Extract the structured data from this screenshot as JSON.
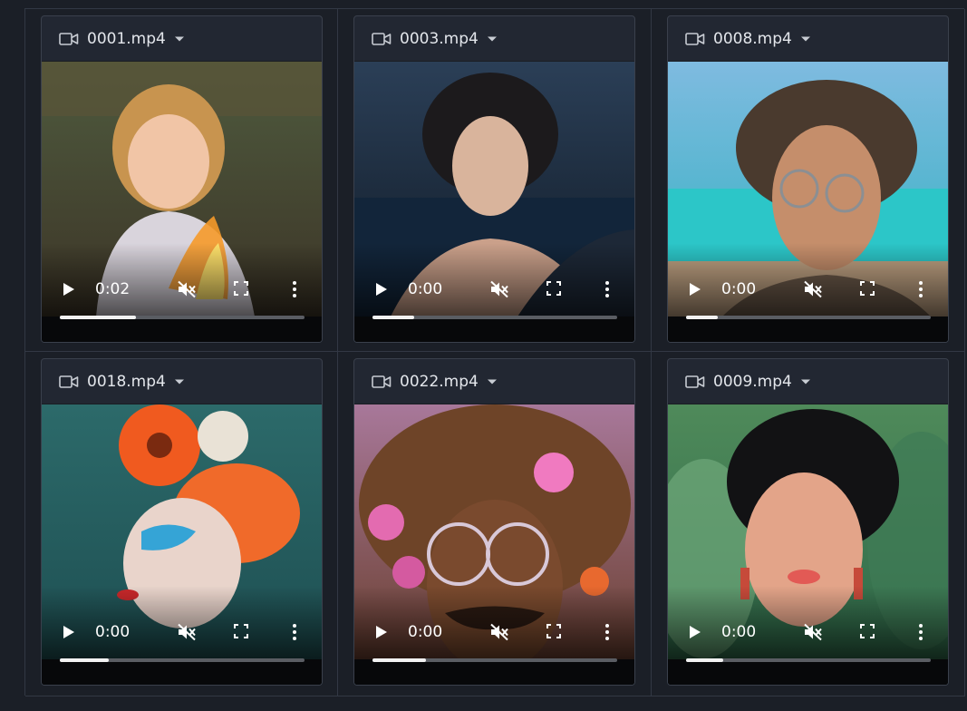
{
  "cards": [
    {
      "filename": "0001.mp4",
      "time": "0:02",
      "progress": 0.31,
      "bg_top": "#4e5a3e",
      "bg_bottom": "#3d3527",
      "subject": "child"
    },
    {
      "filename": "0003.mp4",
      "time": "0:00",
      "progress": 0.17,
      "bg_top": "#2b3f57",
      "bg_bottom": "#101a26",
      "subject": "woman"
    },
    {
      "filename": "0008.mp4",
      "time": "0:00",
      "progress": 0.13,
      "bg_top": "#7fbbe0",
      "bg_bottom": "#2fb0c0",
      "subject": "man"
    },
    {
      "filename": "0018.mp4",
      "time": "0:00",
      "progress": 0.2,
      "bg_top": "#2c6a6a",
      "bg_bottom": "#1e4f52",
      "subject": "woman-flowers"
    },
    {
      "filename": "0022.mp4",
      "time": "0:00",
      "progress": 0.22,
      "bg_top": "#a8789a",
      "bg_bottom": "#6b4030",
      "subject": "man-afro"
    },
    {
      "filename": "0009.mp4",
      "time": "0:00",
      "progress": 0.15,
      "bg_top": "#4f8a5a",
      "bg_bottom": "#2f6a4a",
      "subject": "woman-dark"
    }
  ],
  "icons": {
    "header": "video-camera-icon",
    "dropdown": "chevron-down-icon",
    "play": "play-icon",
    "mute": "muted-speaker-icon",
    "fullscreen": "fullscreen-icon",
    "more": "more-options-icon"
  },
  "colors": {
    "page_bg": "#1b1f27",
    "card_bg": "#222732",
    "border": "#323844",
    "text": "#e3e6eb"
  }
}
